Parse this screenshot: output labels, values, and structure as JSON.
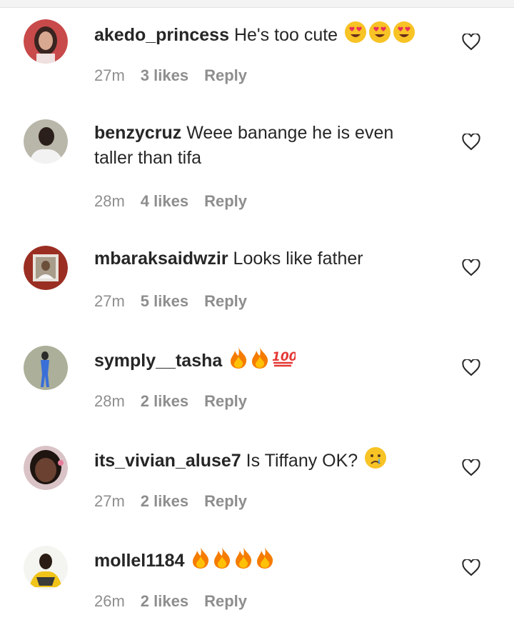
{
  "comments": [
    {
      "username": "akedo_princess",
      "text": "He's too cute",
      "emojis": [
        "heart-eyes",
        "heart-eyes",
        "heart-eyes"
      ],
      "time": "27m",
      "likes": "3 likes",
      "reply": "Reply",
      "avatar_colors": [
        "#c94a4a",
        "#3a2420",
        "#d8a890"
      ]
    },
    {
      "username": "benzycruz",
      "text": "Weee banange he is even taller than tifa",
      "emojis": [],
      "time": "28m",
      "likes": "4 likes",
      "reply": "Reply",
      "avatar_colors": [
        "#b9b6aa",
        "#2a1f1a",
        "#f2f2f2"
      ]
    },
    {
      "username": "mbaraksaidwzir",
      "text": "Looks like father",
      "emojis": [],
      "time": "27m",
      "likes": "5 likes",
      "reply": "Reply",
      "avatar_colors": [
        "#9a2e22",
        "#e8e3dc",
        "#6b4f3a"
      ]
    },
    {
      "username": "symply__tasha",
      "text": "",
      "emojis": [
        "fire",
        "fire",
        "hundred"
      ],
      "time": "28m",
      "likes": "2 likes",
      "reply": "Reply",
      "avatar_colors": [
        "#8f9a7c",
        "#2b2b2b",
        "#3a6fd8"
      ]
    },
    {
      "username": "its_vivian_aluse7",
      "text": "Is Tiffany OK?",
      "emojis": [
        "crying-face"
      ],
      "time": "27m",
      "likes": "2 likes",
      "reply": "Reply",
      "avatar_colors": [
        "#d9c3c6",
        "#6b4232",
        "#1e1410"
      ]
    },
    {
      "username": "mollel1184",
      "text": "",
      "emojis": [
        "fire",
        "fire",
        "fire",
        "fire"
      ],
      "time": "26m",
      "likes": "2 likes",
      "reply": "Reply",
      "avatar_colors": [
        "#f4f4f0",
        "#f0c419",
        "#2a1c14"
      ]
    }
  ],
  "colors": {
    "username": "#262626",
    "meta": "#8e8e8e",
    "heart_outline": "#262626"
  }
}
